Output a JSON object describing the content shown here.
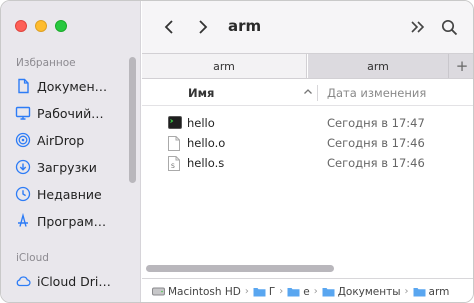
{
  "sidebar": {
    "favorites_header": "Избранное",
    "favorites": [
      {
        "label": "Докумен…",
        "icon": "document-icon"
      },
      {
        "label": "Рабочий…",
        "icon": "desktop-icon"
      },
      {
        "label": "AirDrop",
        "icon": "airdrop-icon"
      },
      {
        "label": "Загрузки",
        "icon": "downloads-icon"
      },
      {
        "label": "Недавние",
        "icon": "clock-icon"
      },
      {
        "label": "Програм…",
        "icon": "applications-icon"
      }
    ],
    "icloud_header": "iCloud",
    "icloud": [
      {
        "label": "iCloud Dri…",
        "icon": "cloud-icon"
      }
    ]
  },
  "toolbar": {
    "title": "arm"
  },
  "tabs": [
    {
      "label": "arm",
      "active": true
    },
    {
      "label": "arm",
      "active": false
    }
  ],
  "tab_add": "+",
  "columns": {
    "name": "Имя",
    "date": "Дата изменения"
  },
  "files": [
    {
      "name": "hello",
      "date": "Сегодня в 17:47",
      "icon": "executable-icon"
    },
    {
      "name": "hello.o",
      "date": "Сегодня в 17:46",
      "icon": "file-icon"
    },
    {
      "name": "hello.s",
      "date": "Сегодня в 17:46",
      "icon": "source-file-icon"
    }
  ],
  "pathbar": [
    {
      "label": "Macintosh HD",
      "icon": "disk-icon"
    },
    {
      "label": "Г",
      "icon": "folder-icon"
    },
    {
      "label": "е",
      "icon": "folder-icon"
    },
    {
      "label": "Документы",
      "icon": "folder-icon"
    },
    {
      "label": "arm",
      "icon": "folder-icon"
    }
  ],
  "colors": {
    "accent": "#2d7cf6",
    "sidebar_bg": "#e9e7ec",
    "folder": "#59a6f0"
  }
}
